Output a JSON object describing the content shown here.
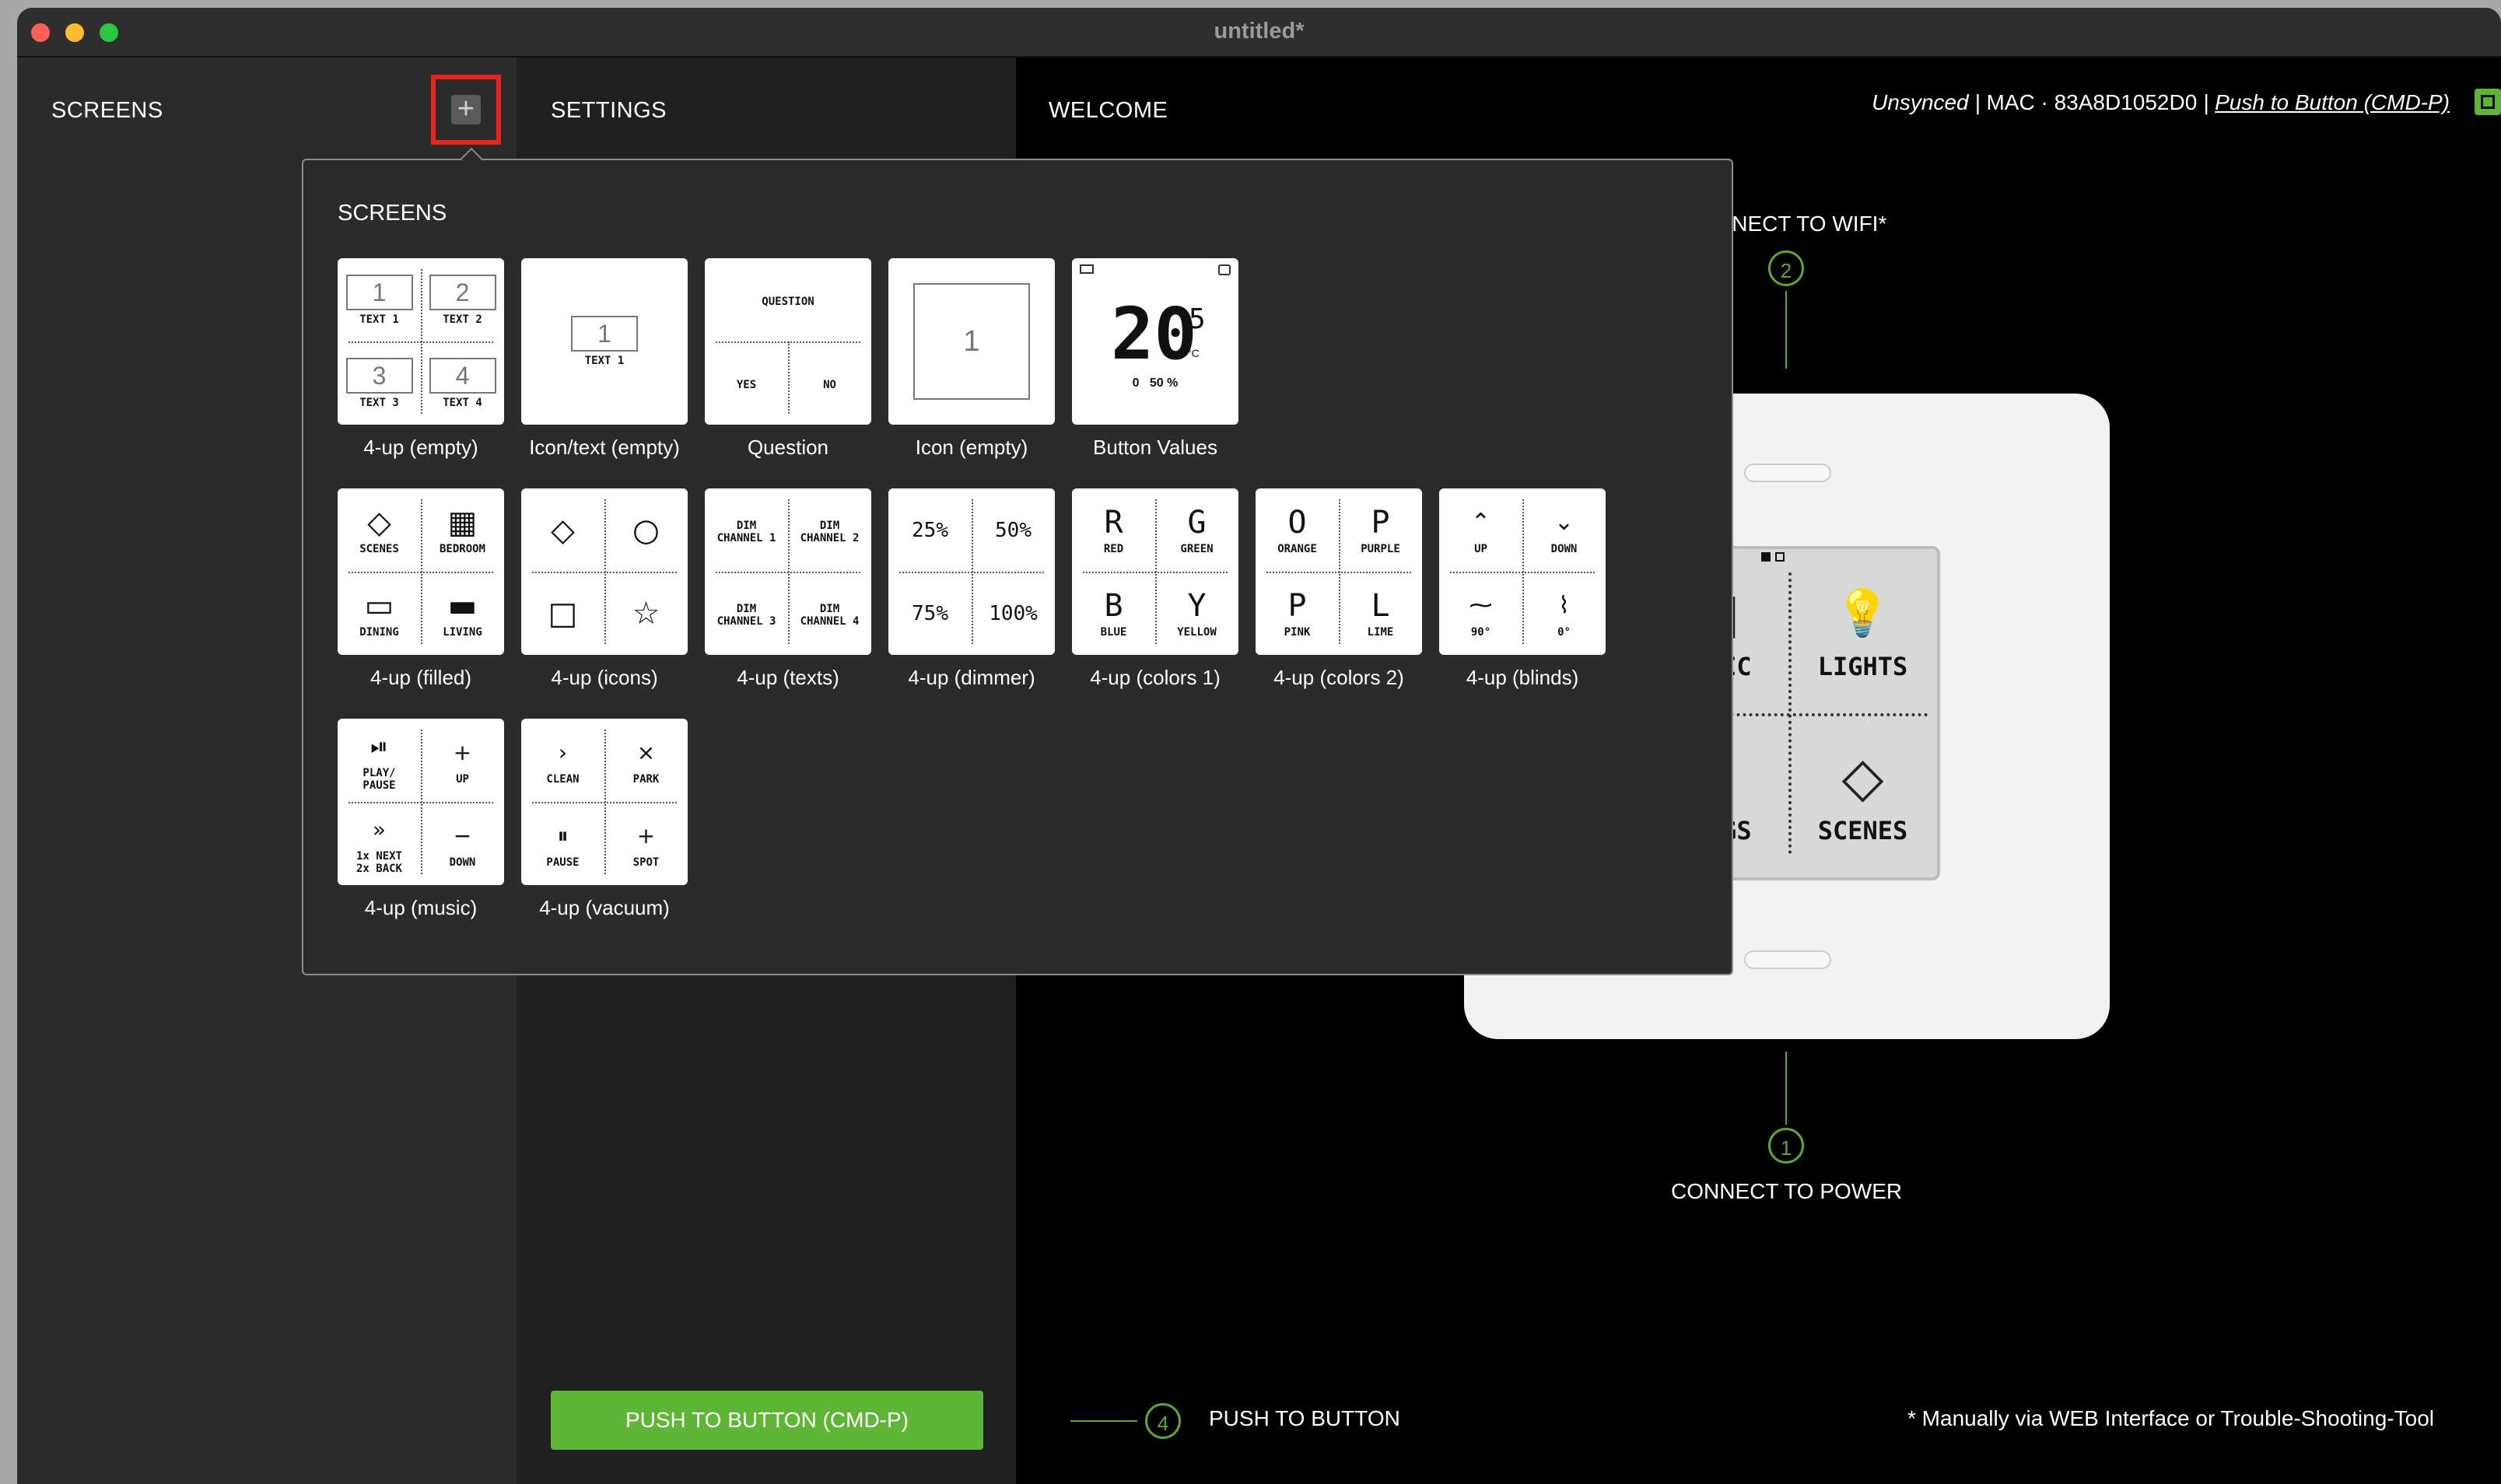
{
  "window": {
    "title": "untitled*"
  },
  "columns": {
    "screens": "SCREENS",
    "settings": "SETTINGS",
    "welcome": "WELCOME"
  },
  "add_button": {
    "icon": "plus-icon"
  },
  "status": {
    "sync": "Unsynced",
    "mac": "MAC · 83A8D1052D0",
    "push_link": "Push to Button (CMD-P)",
    "separator": "|"
  },
  "popup": {
    "title": "SCREENS",
    "tiles": [
      {
        "label": "4-up (empty)",
        "quad_numbers": [
          "1",
          "2",
          "3",
          "4"
        ],
        "quad_texts": [
          "TEXT 1",
          "TEXT 2",
          "TEXT 3",
          "TEXT 4"
        ]
      },
      {
        "label": "Icon/text (empty)",
        "number": "1",
        "text": "TEXT 1"
      },
      {
        "label": "Question",
        "question": "QUESTION",
        "yes": "YES",
        "no": "NO"
      },
      {
        "label": "Icon (empty)",
        "number": "1"
      },
      {
        "label": "Button Values",
        "big": "20",
        "unit": "5",
        "unit_small": "°C",
        "bottom": "0   50 %"
      },
      {
        "label": "4-up (filled)",
        "quads": [
          [
            "◇",
            "SCENES"
          ],
          [
            "▦",
            "BEDROOM"
          ],
          [
            "▭",
            "DINING"
          ],
          [
            "▬",
            "LIVING"
          ]
        ]
      },
      {
        "label": "4-up (icons)",
        "quads": [
          [
            "◇",
            ""
          ],
          [
            "○",
            ""
          ],
          [
            "□",
            ""
          ],
          [
            "☆",
            ""
          ]
        ]
      },
      {
        "label": "4-up (texts)",
        "quads": [
          [
            "",
            "DIM\nCHANNEL 1"
          ],
          [
            "",
            "DIM\nCHANNEL 2"
          ],
          [
            "",
            "DIM\nCHANNEL 3"
          ],
          [
            "",
            "DIM\nCHANNEL 4"
          ]
        ]
      },
      {
        "label": "4-up (dimmer)",
        "quads": [
          [
            "25%",
            ""
          ],
          [
            "50%",
            ""
          ],
          [
            "75%",
            ""
          ],
          [
            "100%",
            ""
          ]
        ]
      },
      {
        "label": "4-up (colors 1)",
        "quads": [
          [
            "R",
            "RED"
          ],
          [
            "G",
            "GREEN"
          ],
          [
            "B",
            "BLUE"
          ],
          [
            "Y",
            "YELLOW"
          ]
        ]
      },
      {
        "label": "4-up (colors 2)",
        "quads": [
          [
            "O",
            "ORANGE"
          ],
          [
            "P",
            "PURPLE"
          ],
          [
            "P",
            "PINK"
          ],
          [
            "L",
            "LIME"
          ]
        ]
      },
      {
        "label": "4-up (blinds)",
        "quads": [
          [
            "⌃",
            "UP"
          ],
          [
            "⌄",
            "DOWN"
          ],
          [
            "⁓",
            "90°"
          ],
          [
            "⌇",
            "0°"
          ]
        ]
      },
      {
        "label": "4-up (music)",
        "quads": [
          [
            "⏯",
            "PLAY/\nPAUSE"
          ],
          [
            "+",
            "UP"
          ],
          [
            "»",
            "1x NEXT\n2x BACK"
          ],
          [
            "−",
            "DOWN"
          ]
        ]
      },
      {
        "label": "4-up (vacuum)",
        "quads": [
          [
            "›",
            "CLEAN"
          ],
          [
            "×",
            "PARK"
          ],
          [
            "⏸",
            "PAUSE"
          ],
          [
            "+",
            "SPOT"
          ]
        ]
      }
    ]
  },
  "welcome": {
    "step1": {
      "num": "1",
      "text": "CONNECT TO POWER"
    },
    "step2": {
      "num": "2",
      "text": "CONNECT TO WIFI*"
    },
    "step4": {
      "num": "4",
      "text": "PUSH TO BUTTON"
    },
    "footnote": "* Manually via WEB Interface or Trouble-Shooting-Tool",
    "device_quads": [
      {
        "icon": "speaker-icon",
        "glyph": "▦",
        "name": "MUSIC"
      },
      {
        "icon": "bulb-icon",
        "glyph": "💡",
        "name": "LIGHTS"
      },
      {
        "icon": "plug-icon",
        "glyph": "⌸",
        "name": "PLUGS"
      },
      {
        "icon": "scenes-icon",
        "glyph": "◇",
        "name": "SCENES"
      }
    ]
  },
  "push_button": "PUSH TO BUTTON (CMD-P)",
  "colors": {
    "accent_green": "#5fb536",
    "highlight_red": "#e8241c"
  }
}
